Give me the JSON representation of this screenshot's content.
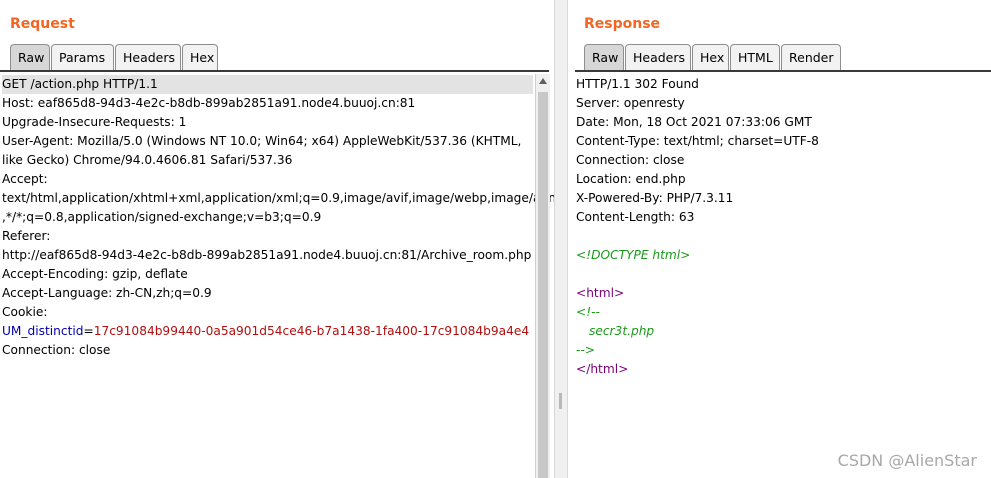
{
  "request": {
    "title": "Request",
    "tabs": [
      {
        "label": "Raw",
        "active": true
      },
      {
        "label": "Params",
        "active": false
      },
      {
        "label": "Headers",
        "active": false
      },
      {
        "label": "Hex",
        "active": false
      }
    ],
    "lines": [
      "GET /action.php HTTP/1.1",
      "Host: eaf865d8-94d3-4e2c-b8db-899ab2851a91.node4.buuoj.cn:81",
      "Upgrade-Insecure-Requests: 1",
      "User-Agent: Mozilla/5.0 (Windows NT 10.0; Win64; x64) AppleWebKit/537.36 (KHTML,",
      "like Gecko) Chrome/94.0.4606.81 Safari/537.36",
      "Accept:",
      "text/html,application/xhtml+xml,application/xml;q=0.9,image/avif,image/webp,image/apng",
      ",*/*;q=0.8,application/signed-exchange;v=b3;q=0.9",
      "Referer:",
      "http://eaf865d8-94d3-4e2c-b8db-899ab2851a91.node4.buuoj.cn:81/Archive_room.php",
      "Accept-Encoding: gzip, deflate",
      "Accept-Language: zh-CN,zh;q=0.9",
      "Cookie:"
    ],
    "cookie": {
      "name": "UM_distinctid",
      "eq": "=",
      "value": "17c91084b99440-0a5a901d54ce46-b7a1438-1fa400-17c91084b9a4e4"
    },
    "last_line": "Connection: close"
  },
  "response": {
    "title": "Response",
    "tabs": [
      {
        "label": "Raw",
        "active": true
      },
      {
        "label": "Headers",
        "active": false
      },
      {
        "label": "Hex",
        "active": false
      },
      {
        "label": "HTML",
        "active": false
      },
      {
        "label": "Render",
        "active": false
      }
    ],
    "header_lines": [
      "HTTP/1.1 302 Found",
      "Server: openresty",
      "Date: Mon, 18 Oct 2021 07:33:06 GMT",
      "Content-Type: text/html; charset=UTF-8",
      "Connection: close",
      "Location: end.php",
      "X-Powered-By: PHP/7.3.11",
      "Content-Length: 63"
    ],
    "body": {
      "doctype": "<!DOCTYPE html>",
      "html_open": "<html>",
      "comment_open": "<!--",
      "comment_text": "secr3t.php",
      "comment_close": "-->",
      "html_close": "</html>"
    }
  },
  "watermark": "CSDN @AlienStar",
  "colors": {
    "title": "#f26522",
    "key": "#0000b0",
    "value": "#b01010",
    "tag": "#7a007a",
    "comment": "#1a9a1a"
  }
}
